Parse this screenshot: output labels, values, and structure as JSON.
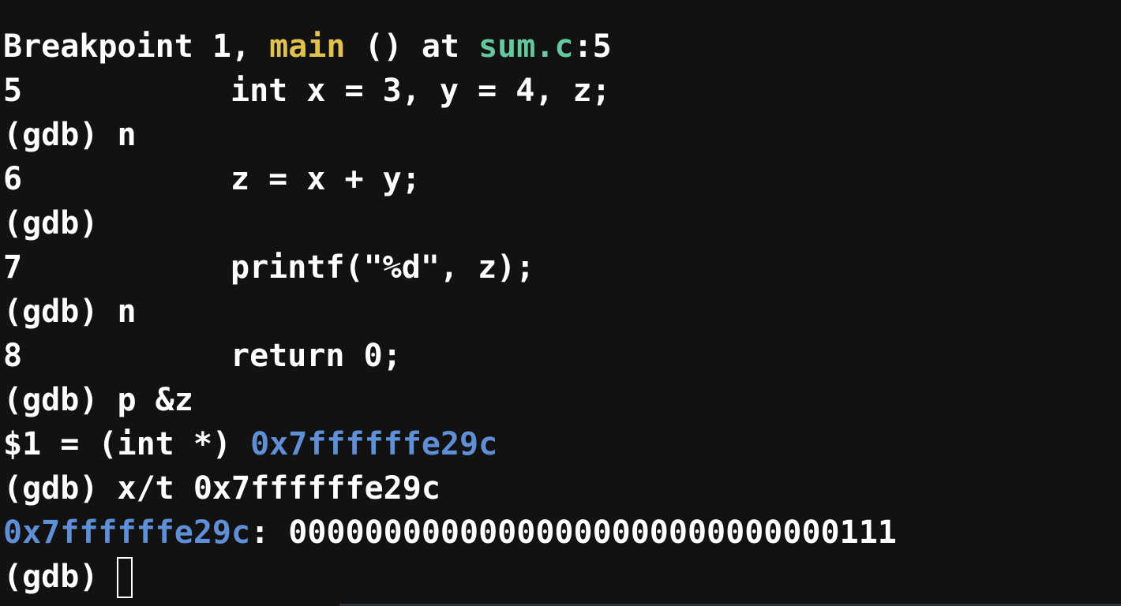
{
  "colors": {
    "background": "#121212",
    "text": "#ffffff",
    "function_name": "#e1c14f",
    "file_name": "#66c8a0",
    "address": "#5f8fd6"
  },
  "lines": {
    "bp": {
      "prefix": "Breakpoint 1, ",
      "func": "main",
      "mid": " () at ",
      "file": "sum.c",
      "suffix": ":5"
    },
    "src5": {
      "num": "5",
      "code": "int x = 3, y = 4, z;"
    },
    "cmd1": {
      "prompt": "(gdb)",
      "input": " n"
    },
    "src6": {
      "num": "6",
      "code": "z = x + y;"
    },
    "cmd2": {
      "prompt": "(gdb)",
      "input": ""
    },
    "src7": {
      "num": "7",
      "code": "printf(\"%d\", z);"
    },
    "cmd3": {
      "prompt": "(gdb)",
      "input": " n"
    },
    "src8": {
      "num": "8",
      "code": "return 0;"
    },
    "cmd4": {
      "prompt": "(gdb)",
      "input": " p &z"
    },
    "print": {
      "prefix": "$1 = (int *) ",
      "address": "0x7ffffffe29c"
    },
    "cmd5": {
      "prompt": "(gdb)",
      "input": " x/t 0x7ffffffe29c"
    },
    "exam": {
      "address": "0x7ffffffe29c",
      "sep": ": ",
      "value": "00000000000000000000000000000111"
    },
    "cmd6": {
      "prompt": "(gdb)",
      "input": ""
    }
  }
}
